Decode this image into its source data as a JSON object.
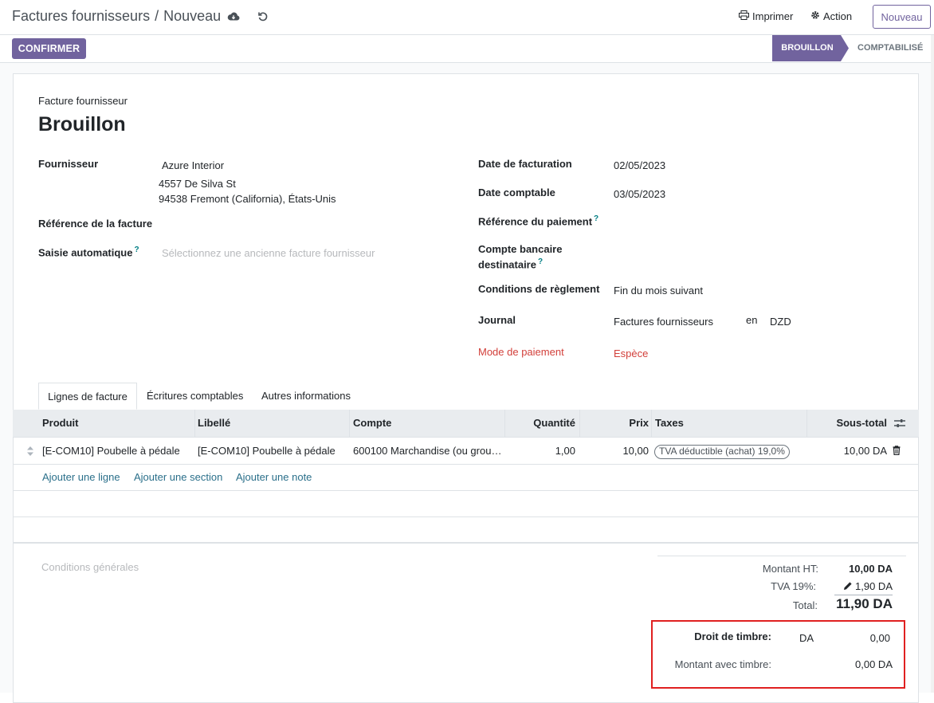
{
  "breadcrumb": {
    "parent": "Factures fournisseurs",
    "separator": "/",
    "current": "Nouveau"
  },
  "toolbar": {
    "print_label": "Imprimer",
    "action_label": "Action",
    "new_label": "Nouveau"
  },
  "statusbar": {
    "confirm_label": "CONFIRMER",
    "stage_active": "BROUILLON",
    "stage_next": "COMPTABILISÉ"
  },
  "form": {
    "doc_type": "Facture fournisseur",
    "title": "Brouillon",
    "left": {
      "vendor_label": "Fournisseur",
      "vendor_name": "Azure Interior",
      "vendor_street": "4557 De Silva St",
      "vendor_city": "94538 Fremont (California), États-Unis",
      "ref_label": "Référence de la facture",
      "auto_label": "Saisie automatique",
      "auto_help": "?",
      "auto_placeholder": "Sélectionnez une ancienne facture fournisseur"
    },
    "right": {
      "invoice_date_label": "Date de facturation",
      "invoice_date": "02/05/2023",
      "acc_date_label": "Date comptable",
      "acc_date": "03/05/2023",
      "payment_ref_label": "Référence du paiement",
      "payment_ref_help": "?",
      "bank_label_1": "Compte bancaire",
      "bank_label_2": "destinataire",
      "bank_help": "?",
      "terms_label": "Conditions de règlement",
      "terms": "Fin du mois suivant",
      "journal_label": "Journal",
      "journal": "Factures fournisseurs",
      "journal_in": "en",
      "currency": "DZD",
      "pay_mode_label": "Mode de paiement",
      "pay_mode": "Espèce"
    }
  },
  "tabs": [
    {
      "label": "Lignes de facture"
    },
    {
      "label": "Écritures comptables"
    },
    {
      "label": "Autres informations"
    }
  ],
  "table": {
    "headers": {
      "product": "Produit",
      "label": "Libellé",
      "account": "Compte",
      "qty": "Quantité",
      "price": "Prix",
      "taxes": "Taxes",
      "subtotal": "Sous-total"
    },
    "rows": [
      {
        "product": "[E-COM10] Poubelle à pédale",
        "label": "[E-COM10] Poubelle à pédale",
        "account": "600100 Marchandise (ou grou…",
        "qty": "1,00",
        "price": "10,00",
        "tax": "TVA déductible (achat) 19,0%",
        "subtotal": "10,00 DA"
      }
    ],
    "add_line": "Ajouter une ligne",
    "add_section": "Ajouter une section",
    "add_note": "Ajouter une note"
  },
  "footer": {
    "terms_placeholder": "Conditions générales",
    "amount_ht_label": "Montant HT:",
    "amount_ht": "10,00 DA",
    "tva_label": "TVA 19%:",
    "tva": "1,90 DA",
    "total_label": "Total:",
    "total": "11,90 DA",
    "stamp_label": "Droit de timbre:",
    "stamp_currency": "DA",
    "stamp_value": "0,00",
    "with_stamp_label": "Montant avec timbre:",
    "with_stamp_value": "0,00 DA"
  },
  "colors": {
    "primary": "#71639e",
    "link": "#017e84",
    "danger": "#d23f3a",
    "highlight_box": "#e02020"
  }
}
